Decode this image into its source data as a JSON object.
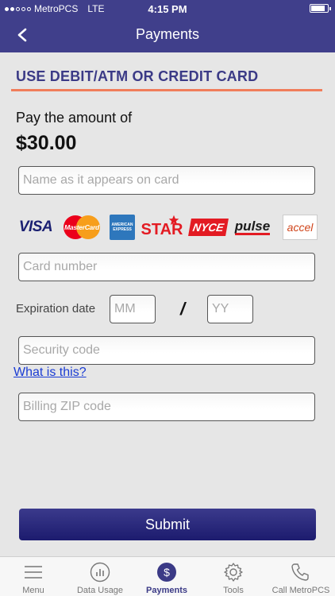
{
  "status_bar": {
    "carrier": "MetroPCS",
    "network": "LTE",
    "time": "4:15 PM"
  },
  "header": {
    "title": "Payments"
  },
  "section": {
    "title": "USE DEBIT/ATM OR CREDIT CARD"
  },
  "payment": {
    "label": "Pay the amount of",
    "amount": "$30.00"
  },
  "form": {
    "name_placeholder": "Name as it appears on card",
    "card_placeholder": "Card number",
    "expiration_label": "Expiration date",
    "month_placeholder": "MM",
    "separator": "/",
    "year_placeholder": "YY",
    "security_placeholder": "Security code",
    "help_link": "What is this?",
    "zip_placeholder": "Billing ZIP code",
    "submit_label": "Submit"
  },
  "card_logos": [
    {
      "name": "VISA",
      "color": "#1a1f71"
    },
    {
      "name": "MasterCard",
      "color": "#eb001b"
    },
    {
      "name": "AMERICAN EXPRESS",
      "color": "#2e77bc"
    },
    {
      "name": "STAR",
      "color": "#e31b23"
    },
    {
      "name": "NYCE",
      "color": "#e31b23"
    },
    {
      "name": "pulse",
      "color": "#1b1b1b"
    },
    {
      "name": "accel",
      "color": "#d0451b"
    }
  ],
  "tabs": [
    {
      "label": "Menu",
      "icon": "menu-icon"
    },
    {
      "label": "Data Usage",
      "icon": "data-usage-icon"
    },
    {
      "label": "Payments",
      "icon": "dollar-icon",
      "active": true
    },
    {
      "label": "Tools",
      "icon": "gear-icon"
    },
    {
      "label": "Call MetroPCS",
      "icon": "phone-icon"
    }
  ],
  "colors": {
    "brand": "#403f8b",
    "accent": "#f07d5b",
    "link": "#1a3cd4"
  }
}
